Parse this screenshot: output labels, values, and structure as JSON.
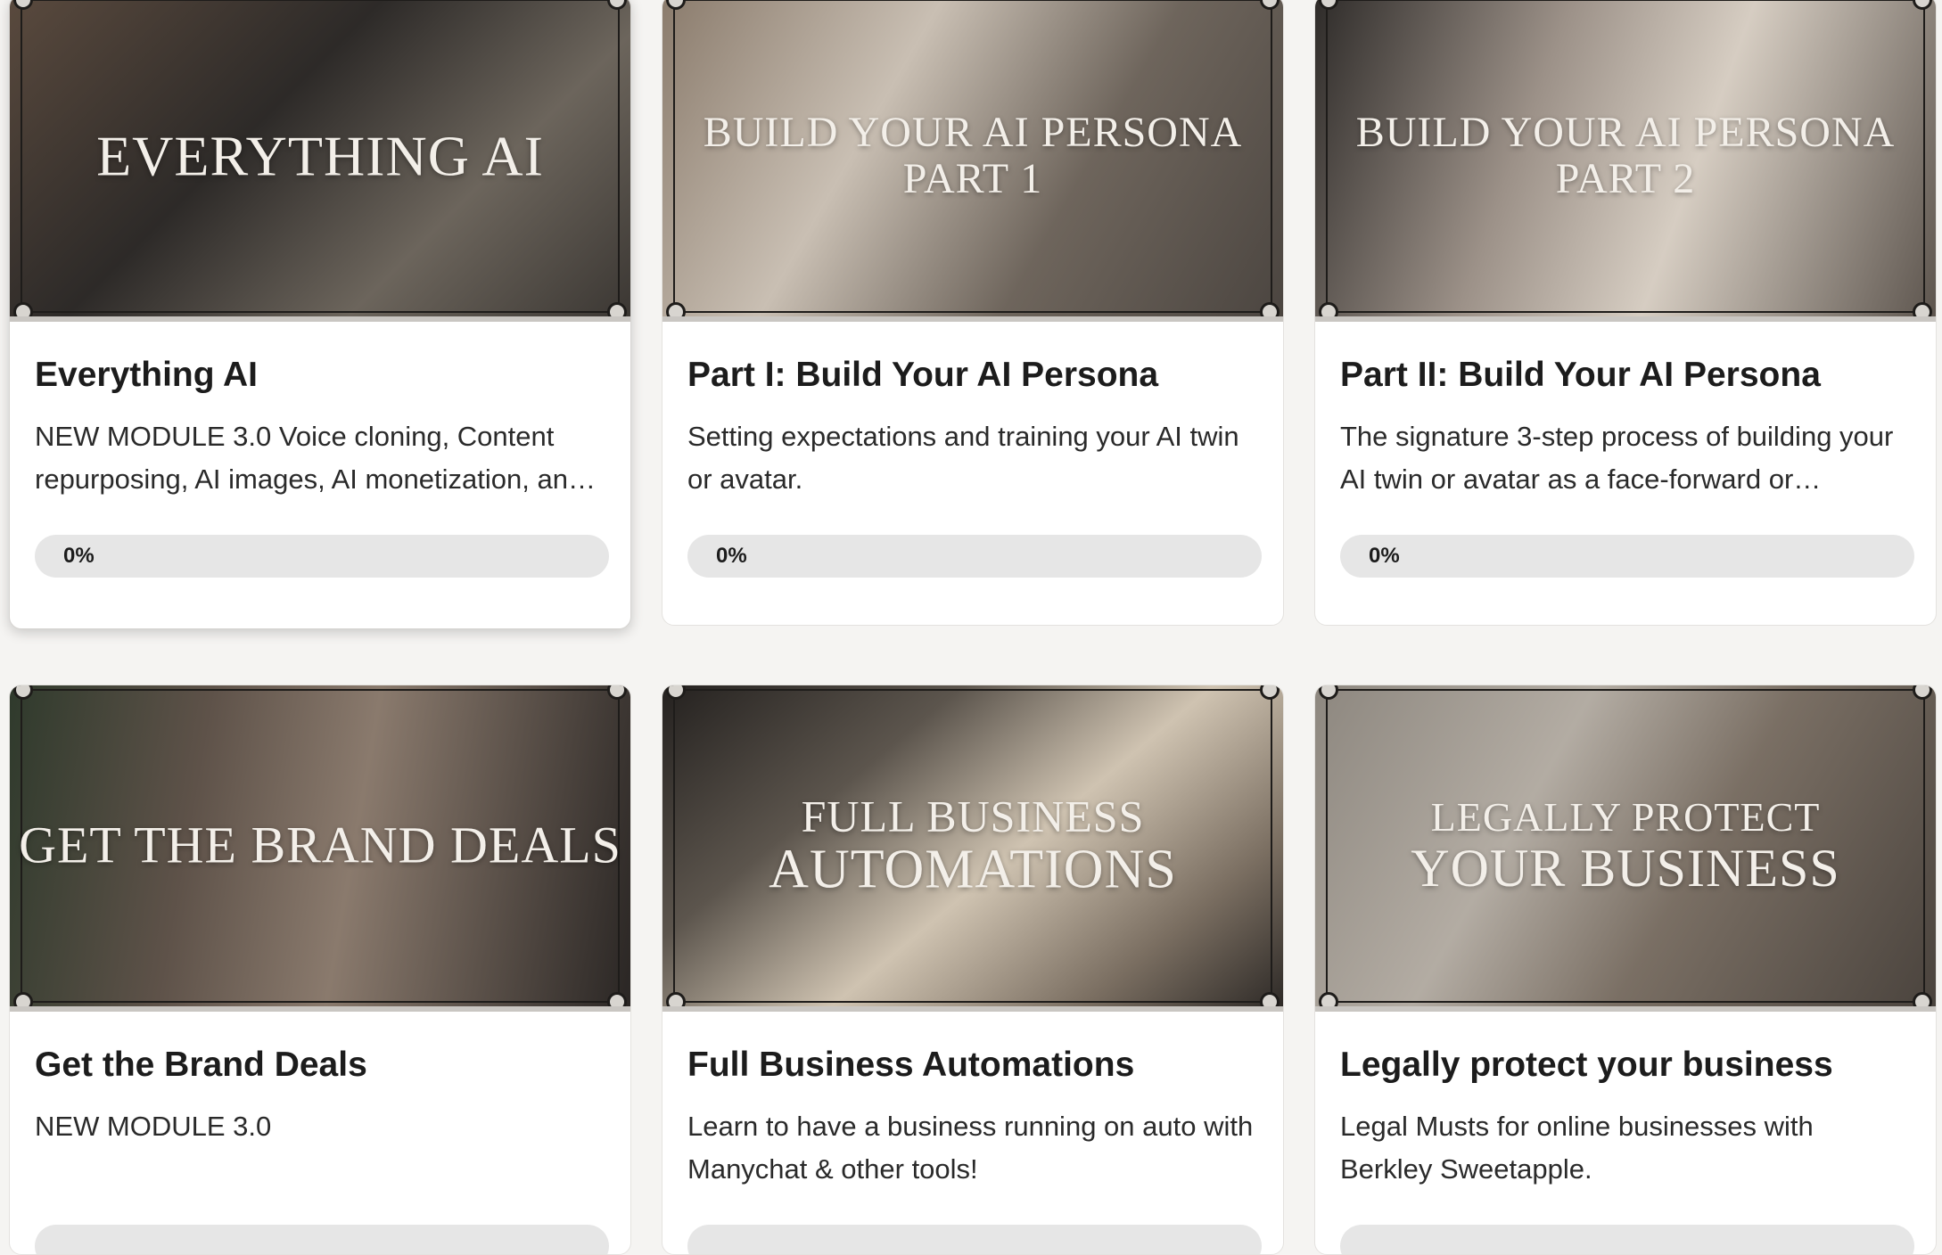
{
  "courses": [
    {
      "thumb_line1": "Everything AI",
      "thumb_line2": "",
      "title": "Everything AI",
      "description": "NEW MODULE 3.0 Voice cloning, Content repurposing, AI images, AI monetization, an…",
      "progress_label": "0%",
      "progress_value": 0
    },
    {
      "thumb_line1": "Build your AI Persona",
      "thumb_line2": "Part 1",
      "title": "Part I: Build Your AI Persona",
      "description": "Setting expectations and training your AI twin or avatar.",
      "progress_label": "0%",
      "progress_value": 0
    },
    {
      "thumb_line1": "Build your AI Persona",
      "thumb_line2": "Part 2",
      "title": "Part II: Build Your AI Persona",
      "description": "The signature 3-step process of building your AI twin or avatar as a face-forward or…",
      "progress_label": "0%",
      "progress_value": 0
    },
    {
      "thumb_line1": "Get the Brand Deals",
      "thumb_line2": "",
      "title": "Get the Brand Deals",
      "description": "NEW MODULE 3.0",
      "progress_label": "",
      "progress_value": 0
    },
    {
      "thumb_line1": "Full Business",
      "thumb_line2": "Automations",
      "title": "Full Business Automations",
      "description": "Learn to have a business running on auto with Manychat & other tools!",
      "progress_label": "",
      "progress_value": 0
    },
    {
      "thumb_line1": "Legally Protect",
      "thumb_line2": "Your Business",
      "title": "Legally protect your business",
      "description": "Legal Musts for online businesses with Berkley Sweetapple.",
      "progress_label": "",
      "progress_value": 0
    }
  ],
  "colors": {
    "page_background": "#f5f4f2",
    "card_background": "#ffffff",
    "progress_track": "#e6e6e6",
    "text_primary": "#1c1c1c"
  }
}
